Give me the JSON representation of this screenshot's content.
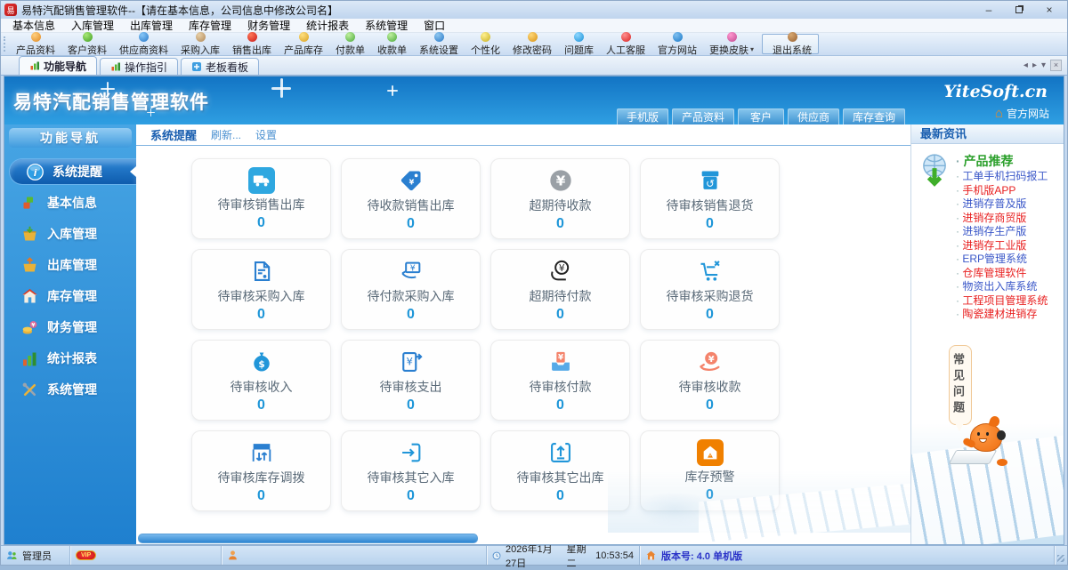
{
  "window": {
    "title": "易特汽配销售管理软件--【请在基本信息，公司信息中修改公司名】",
    "logo_text": "易"
  },
  "menu": {
    "items": [
      "基本信息",
      "入库管理",
      "出库管理",
      "库存管理",
      "财务管理",
      "统计报表",
      "系统管理",
      "窗口"
    ]
  },
  "toolbar": {
    "items": [
      {
        "label": "产品资料",
        "c1": "#e08820",
        "c2": "#ffd080"
      },
      {
        "label": "客户资料",
        "c1": "#3f9e20",
        "c2": "#a8e878"
      },
      {
        "label": "供应商资料",
        "c1": "#2878c8",
        "c2": "#88c8f8"
      },
      {
        "label": "采购入库",
        "c1": "#b08858",
        "c2": "#e8d0a8"
      },
      {
        "label": "销售出库",
        "c1": "#c81818",
        "c2": "#ff7858"
      },
      {
        "label": "产品库存",
        "c1": "#d8a020",
        "c2": "#ffe080"
      },
      {
        "label": "付款单",
        "c1": "#48a838",
        "c2": "#c0f0a0"
      },
      {
        "label": "收款单",
        "c1": "#48a838",
        "c2": "#c0f0a0"
      },
      {
        "label": "系统设置",
        "c1": "#2878c8",
        "c2": "#90c8f0"
      },
      {
        "label": "个性化",
        "c1": "#c8b020",
        "c2": "#fff090"
      },
      {
        "label": "修改密码",
        "c1": "#d89010",
        "c2": "#ffd878"
      },
      {
        "label": "问题库",
        "c1": "#1890d8",
        "c2": "#90d8ff"
      },
      {
        "label": "人工客服",
        "c1": "#d82020",
        "c2": "#ff9090"
      },
      {
        "label": "官方网站",
        "c1": "#1878c8",
        "c2": "#80c0f0"
      },
      {
        "label": "更换皮肤",
        "c1": "#c04890",
        "c2": "#ff98d0",
        "caret": true
      },
      {
        "label": "退出系统",
        "c1": "#986030",
        "c2": "#d8a870",
        "sep": true,
        "raised": true
      }
    ]
  },
  "tabs": [
    {
      "label": "功能导航",
      "icon": "s-tabchart",
      "active": true
    },
    {
      "label": "操作指引",
      "icon": "s-tabchart",
      "active": false
    },
    {
      "label": "老板看板",
      "icon": "s-plus",
      "active": false
    }
  ],
  "banner": {
    "title": "易特汽配销售管理软件",
    "brand": "YiteSoft.cn",
    "buttons": [
      "手机版",
      "产品资料",
      "客户",
      "供应商",
      "库存查询"
    ],
    "site_link": "官方网站"
  },
  "sidebar": {
    "header": "功能导航",
    "items": [
      {
        "label": "系统提醒",
        "icon": "s-info",
        "active": true
      },
      {
        "label": "基本信息",
        "icon": "s-cubes",
        "active": false
      },
      {
        "label": "入库管理",
        "icon": "s-basket-in",
        "active": false
      },
      {
        "label": "出库管理",
        "icon": "s-basket-out",
        "active": false
      },
      {
        "label": "库存管理",
        "icon": "s-house",
        "active": false
      },
      {
        "label": "财务管理",
        "icon": "s-finance",
        "active": false
      },
      {
        "label": "统计报表",
        "icon": "s-chart",
        "active": false
      },
      {
        "label": "系统管理",
        "icon": "s-tools",
        "active": false
      }
    ]
  },
  "main": {
    "section_title": "系统提醒",
    "links": [
      "刷新...",
      "设置"
    ],
    "cards": [
      {
        "label": "待审核销售出库",
        "value": "0",
        "icon": "i-truck",
        "color": "#ffffff",
        "boxed": true,
        "bg": "#2ea7e0"
      },
      {
        "label": "待收款销售出库",
        "value": "0",
        "icon": "i-tag",
        "color": "#2a7fd0"
      },
      {
        "label": "超期待收款",
        "value": "0",
        "icon": "i-yen-fill",
        "color": "#9aa0a6"
      },
      {
        "label": "待审核销售退货",
        "value": "0",
        "icon": "i-return",
        "color": "#2196d9"
      },
      {
        "label": "待审核采购入库",
        "value": "0",
        "icon": "i-doc",
        "color": "#2a7fd0"
      },
      {
        "label": "待付款采购入库",
        "value": "0",
        "icon": "i-paynote",
        "color": "#2a7fd0"
      },
      {
        "label": "超期待付款",
        "value": "0",
        "icon": "i-yen-hand",
        "color": "#222222"
      },
      {
        "label": "待审核采购退货",
        "value": "0",
        "icon": "i-cartx",
        "color": "#2196d9"
      },
      {
        "label": "待审核收入",
        "value": "0",
        "icon": "i-bag",
        "color": "#2196d9"
      },
      {
        "label": "待审核支出",
        "value": "0",
        "icon": "i-yenout",
        "color": "#2a7fd0"
      },
      {
        "label": "待审核付款",
        "value": "0",
        "icon": "i-tray",
        "color": "#4aa3e8"
      },
      {
        "label": "待审核收款",
        "value": "0",
        "icon": "i-coinhand",
        "color": "#f4836b"
      },
      {
        "label": "待审核库存调拨",
        "value": "0",
        "icon": "i-transfer",
        "color": "#2a7fd0"
      },
      {
        "label": "待审核其它入库",
        "value": "0",
        "icon": "i-boxin",
        "color": "#2196d9"
      },
      {
        "label": "待审核其它出库",
        "value": "0",
        "icon": "i-boxout",
        "color": "#2196d9"
      },
      {
        "label": "库存预警",
        "value": "0",
        "icon": "i-homealert",
        "color": "#ffffff",
        "boxed": true,
        "bg": "#f08000"
      }
    ]
  },
  "news": {
    "header": "最新资讯",
    "bubble": "常见问题",
    "items": [
      {
        "label": "产品推荐",
        "color": "#2ca02c",
        "big": true
      },
      {
        "label": "工单手机扫码报工",
        "color": "#3a57c8"
      },
      {
        "label": "手机版APP",
        "color": "#e82020"
      },
      {
        "label": "进销存普及版",
        "color": "#3a57c8"
      },
      {
        "label": "进销存商贸版",
        "color": "#e82020"
      },
      {
        "label": "进销存生产版",
        "color": "#3a57c8"
      },
      {
        "label": "进销存工业版",
        "color": "#e82020"
      },
      {
        "label": "ERP管理系统",
        "color": "#3a57c8"
      },
      {
        "label": "仓库管理软件",
        "color": "#e82020"
      },
      {
        "label": "物资出入库系统",
        "color": "#3a57c8"
      },
      {
        "label": "工程项目管理系统",
        "color": "#e82020"
      },
      {
        "label": "陶瓷建材进销存",
        "color": "#e82020"
      }
    ]
  },
  "statusbar": {
    "user": "管理员",
    "vip": "VIP",
    "date": "2026年1月27日",
    "weekday": "星期二",
    "time": "10:53:54",
    "version": "版本号: 4.0 单机版"
  },
  "colors": {
    "banner_top": "#1274c4",
    "banner_bottom": "#2f9fe2",
    "sidebar_blue": "#2e96e0",
    "count_blue": "#1e96d8",
    "alert_orange": "#f08000"
  }
}
